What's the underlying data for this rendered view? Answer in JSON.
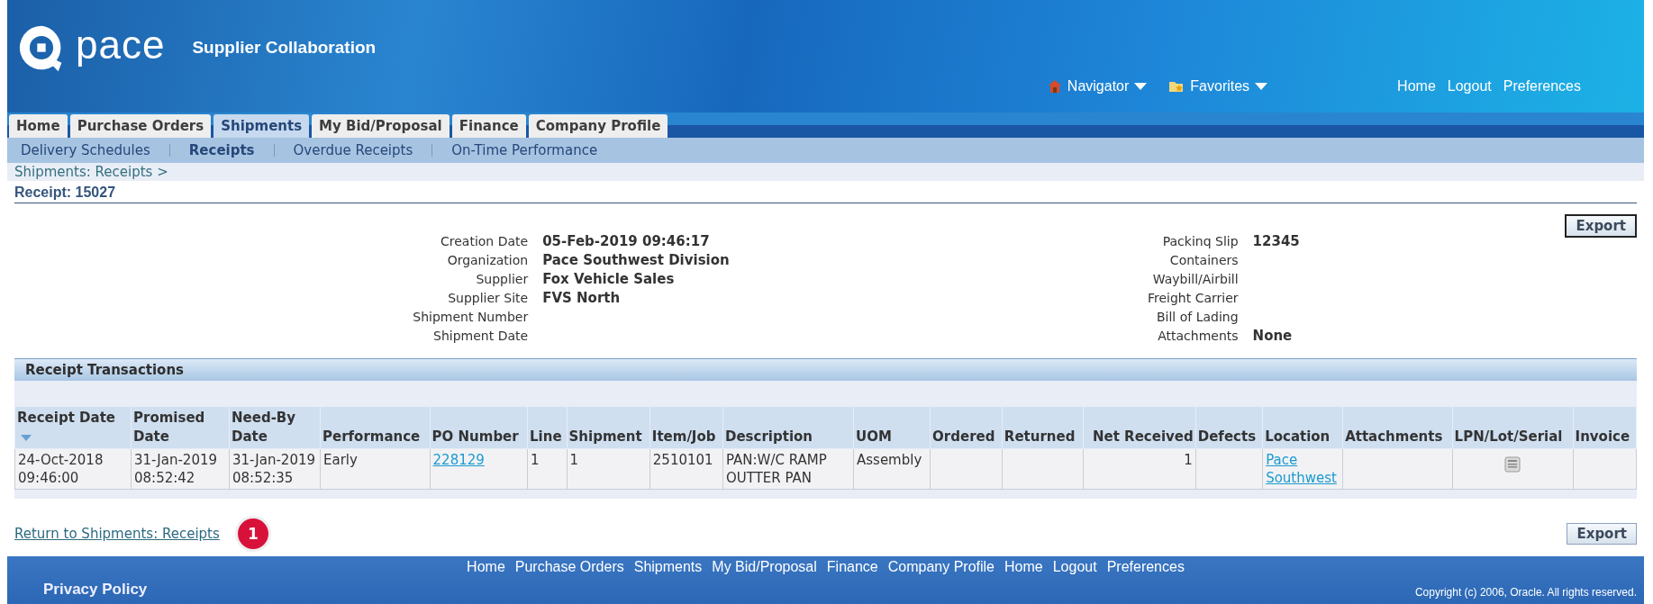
{
  "header": {
    "logo_text": "pace",
    "app_title": "Supplier Collaboration",
    "menus": [
      {
        "label": "Navigator",
        "kind": "home"
      },
      {
        "label": "Favorites",
        "kind": "favorites"
      }
    ],
    "links": [
      "Home",
      "Logout",
      "Preferences"
    ]
  },
  "tabs": [
    {
      "label": "Home",
      "selected": false
    },
    {
      "label": "Purchase Orders",
      "selected": false
    },
    {
      "label": "Shipments",
      "selected": true
    },
    {
      "label": "My Bid/Proposal",
      "selected": false
    },
    {
      "label": "Finance",
      "selected": false
    },
    {
      "label": "Company Profile",
      "selected": false
    }
  ],
  "subtabs": [
    {
      "label": "Delivery Schedules",
      "selected": false
    },
    {
      "label": "Receipts",
      "selected": true
    },
    {
      "label": "Overdue Receipts",
      "selected": false
    },
    {
      "label": "On-Time Performance",
      "selected": false
    }
  ],
  "breadcrumb": "Shipments: Receipts >",
  "page_title": "Receipt: 15027",
  "export_top": "Export",
  "details_left": [
    {
      "label": "Creation Date",
      "value": "05-Feb-2019 09:46:17"
    },
    {
      "label": "Organization",
      "value": "Pace Southwest Division"
    },
    {
      "label": "Supplier",
      "value": "Fox Vehicle Sales"
    },
    {
      "label": "Supplier Site",
      "value": "FVS North"
    },
    {
      "label": "Shipment Number"
    },
    {
      "label": "Shipment Date"
    }
  ],
  "details_right": [
    {
      "label": "Packinq Slip",
      "value": "12345"
    },
    {
      "label": "Containers"
    },
    {
      "label": "Waybill/Airbill"
    },
    {
      "label": "Freight Carrier"
    },
    {
      "label": "Bill of Lading"
    },
    {
      "label": "Attachments",
      "value": "None"
    }
  ],
  "section_title": "Receipt Transactions",
  "table": {
    "columns": [
      {
        "label": "Receipt Date",
        "sorted": true,
        "kind": "text"
      },
      {
        "label": "Promised Date",
        "sorted": false,
        "kind": "text"
      },
      {
        "label": "Need-By Date",
        "sorted": false,
        "kind": "text"
      },
      {
        "label": "Performance",
        "sorted": false,
        "kind": "text"
      },
      {
        "label": "PO Number",
        "sorted": false,
        "kind": "text"
      },
      {
        "label": "Line",
        "sorted": false,
        "kind": "text"
      },
      {
        "label": "Shipment",
        "sorted": false,
        "kind": "text"
      },
      {
        "label": "Item/Job",
        "sorted": false,
        "kind": "text"
      },
      {
        "label": "Description",
        "sorted": false,
        "kind": "text"
      },
      {
        "label": "UOM",
        "sorted": false,
        "kind": "text"
      },
      {
        "label": "Ordered",
        "sorted": false,
        "kind": "text"
      },
      {
        "label": "Returned",
        "sorted": false,
        "kind": "text"
      },
      {
        "label": "Net Received",
        "sorted": false,
        "kind": "number"
      },
      {
        "label": "Defects",
        "sorted": false,
        "kind": "text"
      },
      {
        "label": "Location",
        "sorted": false,
        "kind": "text"
      },
      {
        "label": "Attachments",
        "sorted": false,
        "kind": "text"
      },
      {
        "label": "LPN/Lot/Serial",
        "sorted": false,
        "kind": "text"
      },
      {
        "label": "Invoice",
        "sorted": false,
        "kind": "text"
      }
    ],
    "rows": [
      [
        {
          "kind": "text",
          "text": "24-Oct-2018 09:46:00"
        },
        {
          "kind": "text",
          "text": "31-Jan-2019 08:52:42"
        },
        {
          "kind": "text",
          "text": "31-Jan-2019 08:52:35"
        },
        {
          "kind": "text",
          "text": "Early"
        },
        {
          "kind": "link",
          "text": "228129"
        },
        {
          "kind": "text",
          "text": "1"
        },
        {
          "kind": "text",
          "text": "1"
        },
        {
          "kind": "text",
          "text": "2510101"
        },
        {
          "kind": "text",
          "text": "PAN:W/C RAMP OUTTER PAN"
        },
        {
          "kind": "text",
          "text": "Assembly"
        },
        {
          "kind": "empty"
        },
        {
          "kind": "empty"
        },
        {
          "kind": "text",
          "text": "1"
        },
        {
          "kind": "empty"
        },
        {
          "kind": "link",
          "text": "Pace Southwest"
        },
        {
          "kind": "empty"
        },
        {
          "kind": "icon"
        },
        {
          "kind": "empty"
        }
      ]
    ]
  },
  "return_link": "Return to Shipments: Receipts",
  "callout": "1",
  "export_bottom": "Export",
  "footer": {
    "links": [
      "Home",
      "Purchase Orders",
      "Shipments",
      "My Bid/Proposal",
      "Finance",
      "Company Profile",
      "Home",
      "Logout",
      "Preferences"
    ],
    "privacy": "Privacy Policy",
    "copyright": "Copyright (c) 2006, Oracle. All rights reserved."
  }
}
